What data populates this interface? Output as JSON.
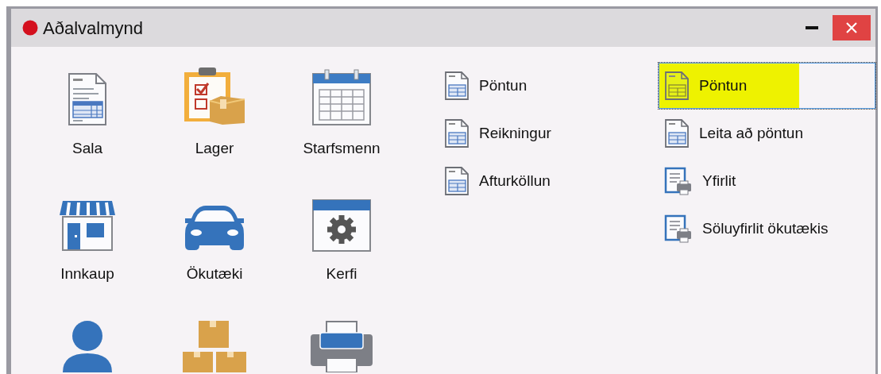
{
  "window": {
    "title": "Aðalvalmynd"
  },
  "tiles": [
    {
      "label": "Sala"
    },
    {
      "label": "Lager"
    },
    {
      "label": "Starfsmenn"
    },
    {
      "label": "Innkaup"
    },
    {
      "label": "Ökutæki"
    },
    {
      "label": "Kerfi"
    }
  ],
  "middle_links": [
    {
      "label": "Pöntun",
      "kind": "form",
      "selected": false,
      "highlighted": false
    },
    {
      "label": "Reikningur",
      "kind": "form",
      "selected": false,
      "highlighted": false
    },
    {
      "label": "Afturköllun",
      "kind": "form",
      "selected": false,
      "highlighted": false
    }
  ],
  "right_links": [
    {
      "label": "Pöntun",
      "kind": "form",
      "selected": true,
      "highlighted": true
    },
    {
      "label": "Leita að pöntun",
      "kind": "form",
      "selected": false,
      "highlighted": false
    },
    {
      "label": "Yfirlit",
      "kind": "report",
      "selected": false,
      "highlighted": false
    },
    {
      "label": "Söluyfirlit ökutækis",
      "kind": "report",
      "selected": false,
      "highlighted": false
    }
  ]
}
